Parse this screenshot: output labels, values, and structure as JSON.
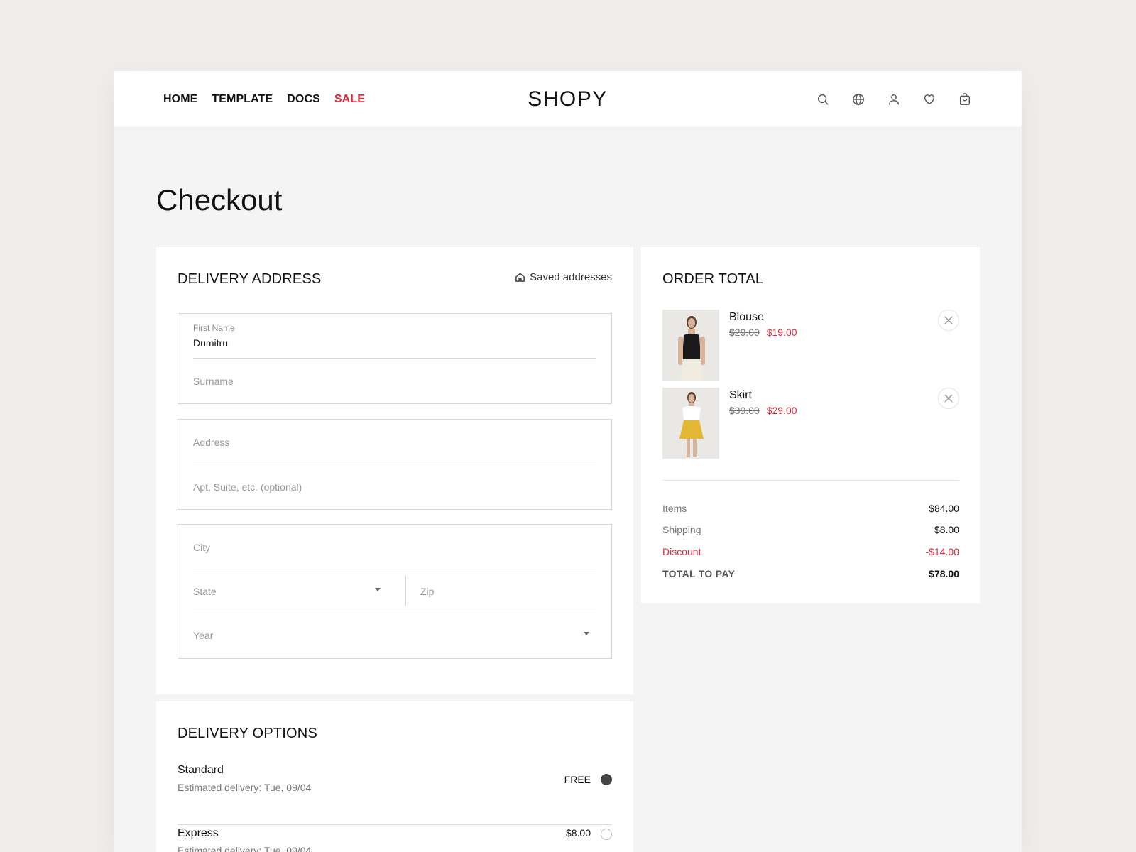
{
  "nav": {
    "items": [
      {
        "label": "HOME"
      },
      {
        "label": "TEMPLATE"
      },
      {
        "label": "DOCS"
      },
      {
        "label": "SALE"
      }
    ]
  },
  "brand": {
    "logo": "SHOPY"
  },
  "header_icons": [
    "search-icon",
    "globe-icon",
    "user-icon",
    "heart-icon",
    "cart-icon"
  ],
  "page": {
    "title": "Checkout"
  },
  "delivery_address": {
    "title": "DELIVERY ADDRESS",
    "saved_link": "Saved addresses",
    "first_name": {
      "label": "First Name",
      "value": "Dumitru"
    },
    "surname": {
      "placeholder": "Surname"
    },
    "address": {
      "placeholder": "Address"
    },
    "apt": {
      "placeholder": "Apt, Suite, etc. (optional)"
    },
    "city": {
      "placeholder": "City"
    },
    "state": {
      "placeholder": "State"
    },
    "zip": {
      "placeholder": "Zip"
    },
    "year": {
      "placeholder": "Year"
    }
  },
  "order_total": {
    "title": "ORDER TOTAL",
    "items": [
      {
        "name": "Blouse",
        "old_price": "$29.00",
        "price": "$19.00"
      },
      {
        "name": "Skirt",
        "old_price": "$39.00",
        "price": "$29.00"
      }
    ],
    "summary": {
      "items_label": "Items",
      "items_value": "$84.00",
      "shipping_label": "Shipping",
      "shipping_value": "$8.00",
      "discount_label": "Discount",
      "discount_value": "-$14.00",
      "total_label": "TOTAL TO PAY",
      "total_value": "$78.00"
    }
  },
  "delivery_options": {
    "title": "DELIVERY OPTIONS",
    "options": [
      {
        "name": "Standard",
        "estimate": "Estimated delivery: Tue, 09/04",
        "price": "FREE",
        "selected": true
      },
      {
        "name": "Express",
        "estimate": "Estimated delivery: Tue, 09/04",
        "price": "$8.00",
        "selected": false
      }
    ]
  },
  "colors": {
    "accent": "#e02a3c",
    "page_bg": "#f4f4f4",
    "card_bg": "#ffffff"
  }
}
